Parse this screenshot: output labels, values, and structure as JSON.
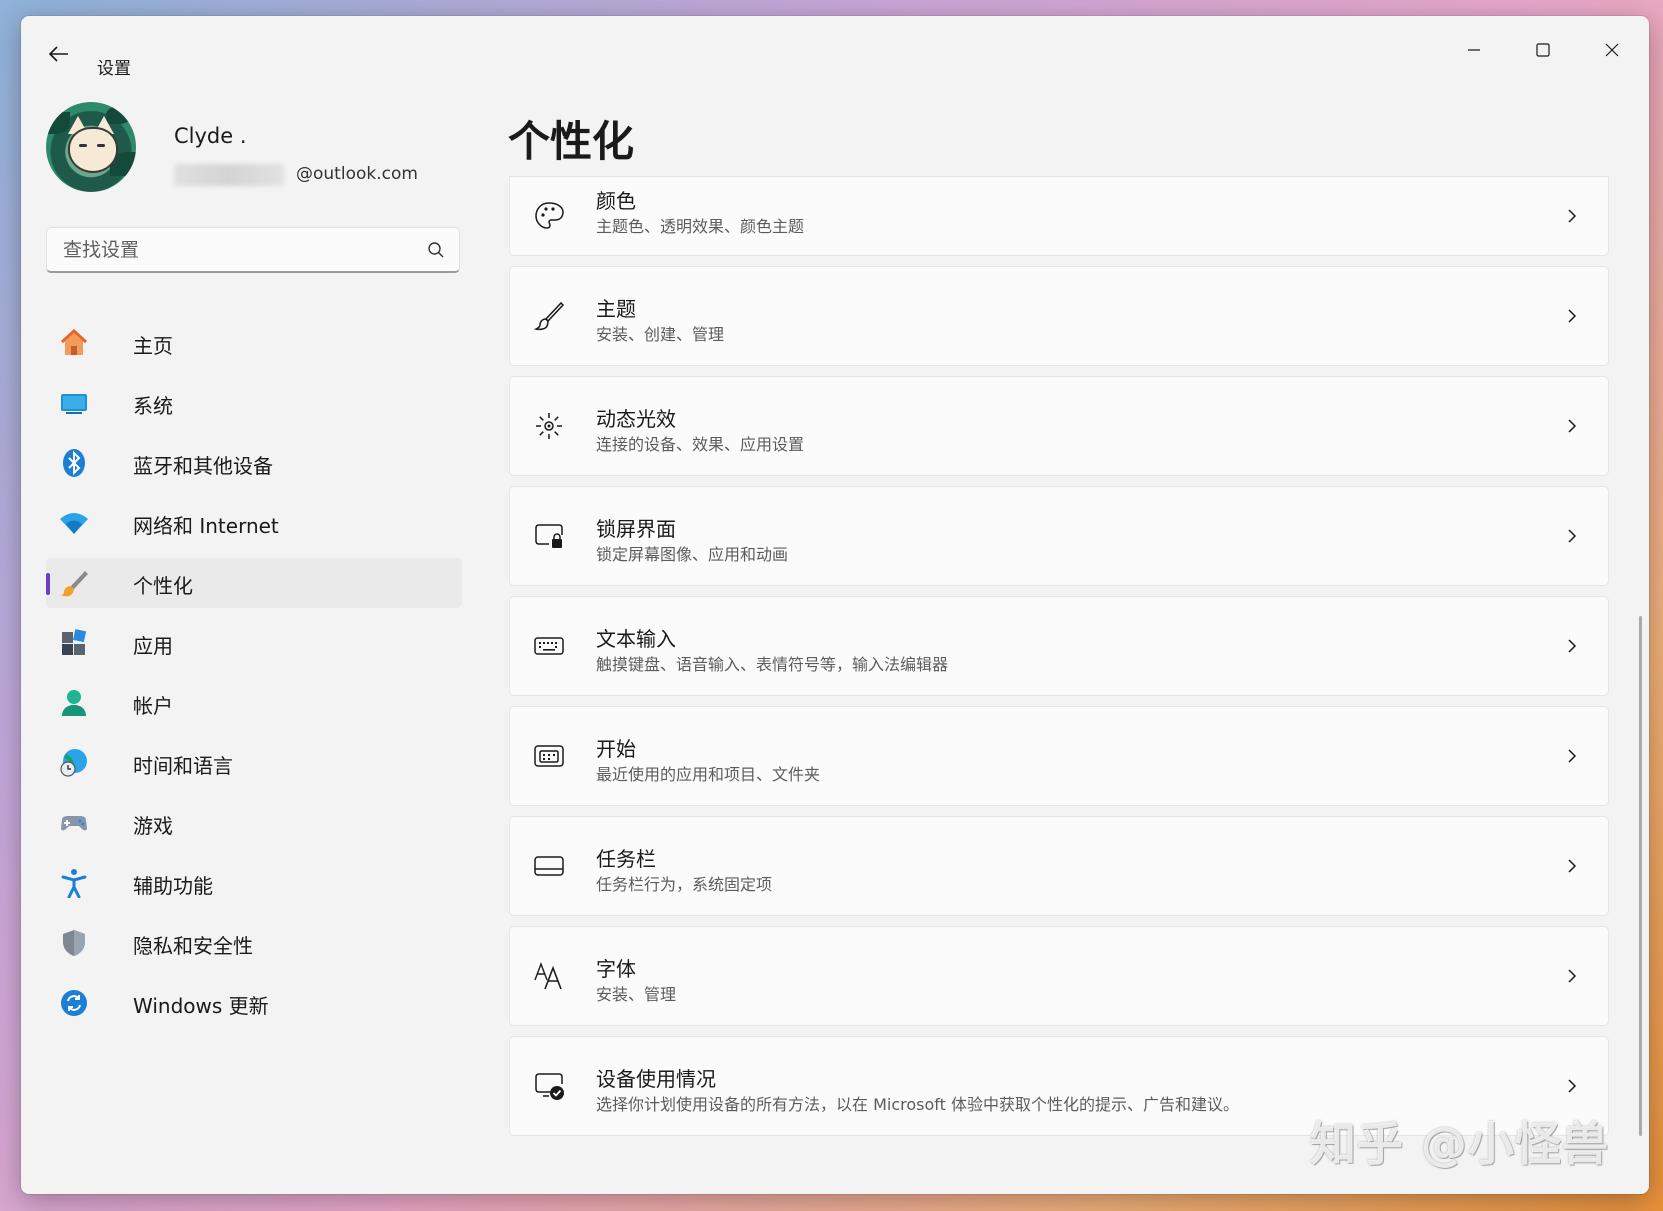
{
  "window": {
    "title": "设置",
    "back_icon": "back-arrow-icon",
    "controls": [
      "minimize-icon",
      "maximize-icon",
      "close-icon"
    ]
  },
  "profile": {
    "name": "Clyde .",
    "email": "@outlook.com"
  },
  "search": {
    "placeholder": "查找设置",
    "value": ""
  },
  "sidebar": {
    "items": [
      {
        "label": "主页",
        "icon": "home-icon",
        "selected": false
      },
      {
        "label": "系统",
        "icon": "system-icon",
        "selected": false
      },
      {
        "label": "蓝牙和其他设备",
        "icon": "bluetooth-icon",
        "selected": false
      },
      {
        "label": "网络和 Internet",
        "icon": "wifi-icon",
        "selected": false
      },
      {
        "label": "个性化",
        "icon": "personalization-brush-icon",
        "selected": true
      },
      {
        "label": "应用",
        "icon": "apps-icon",
        "selected": false
      },
      {
        "label": "帐户",
        "icon": "account-icon",
        "selected": false
      },
      {
        "label": "时间和语言",
        "icon": "time-language-icon",
        "selected": false
      },
      {
        "label": "游戏",
        "icon": "gaming-icon",
        "selected": false
      },
      {
        "label": "辅助功能",
        "icon": "accessibility-icon",
        "selected": false
      },
      {
        "label": "隐私和安全性",
        "icon": "privacy-shield-icon",
        "selected": false
      },
      {
        "label": "Windows 更新",
        "icon": "windows-update-icon",
        "selected": false
      }
    ]
  },
  "main": {
    "title": "个性化",
    "cards": [
      {
        "title": "颜色",
        "desc": "主题色、透明效果、颜色主题",
        "icon": "palette-icon"
      },
      {
        "title": "主题",
        "desc": "安装、创建、管理",
        "icon": "brush-icon"
      },
      {
        "title": "动态光效",
        "desc": "连接的设备、效果、应用设置",
        "icon": "dynamic-lighting-icon"
      },
      {
        "title": "锁屏界面",
        "desc": "锁定屏幕图像、应用和动画",
        "icon": "lock-screen-icon"
      },
      {
        "title": "文本输入",
        "desc": "触摸键盘、语音输入、表情符号等，输入法编辑器",
        "icon": "keyboard-icon"
      },
      {
        "title": "开始",
        "desc": "最近使用的应用和项目、文件夹",
        "icon": "start-menu-icon"
      },
      {
        "title": "任务栏",
        "desc": "任务栏行为，系统固定项",
        "icon": "taskbar-icon"
      },
      {
        "title": "字体",
        "desc": "安装、管理",
        "icon": "fonts-icon"
      },
      {
        "title": "设备使用情况",
        "desc": "选择你计划使用设备的所有方法，以在 Microsoft 体验中获取个性化的提示、广告和建议。",
        "icon": "device-usage-icon"
      }
    ]
  },
  "watermark": "知乎 @小怪兽",
  "colors": {
    "accent": "#6b3fc4",
    "window_bg": "#f3f3f3",
    "card_bg": "#fbfbfb"
  }
}
